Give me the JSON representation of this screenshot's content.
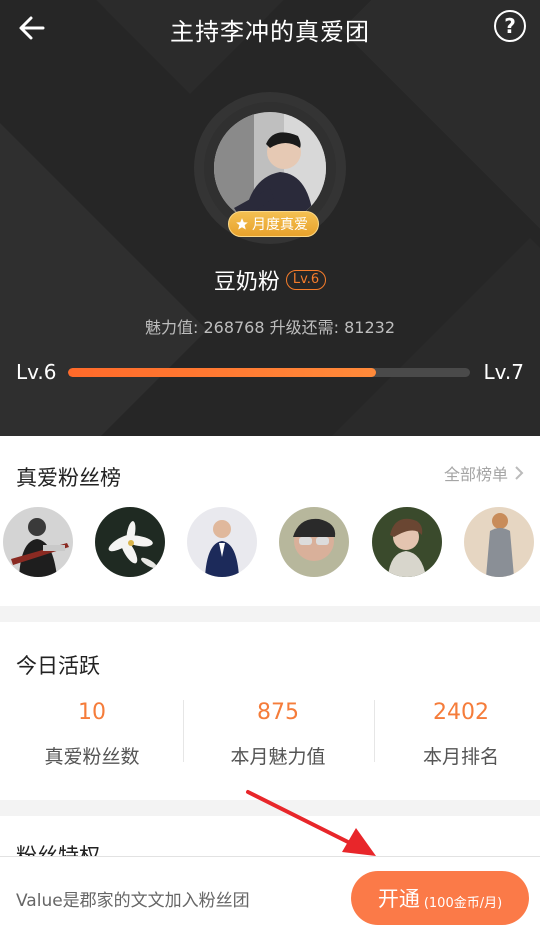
{
  "header": {
    "title": "主持李冲的真爱团",
    "back_icon": "back-arrow-icon",
    "help_icon": "question-circle-icon",
    "help_symbol": "?"
  },
  "profile": {
    "badge_label": "月度真爱",
    "badge_icon": "star-icon",
    "username": "豆奶粉",
    "level_tag": "Lv.6",
    "charm_line": "魅力值: 268768 升级还需: 81232",
    "current_level": "Lv.6",
    "next_level": "Lv.7",
    "progress_fraction": 0.766
  },
  "fans_rank": {
    "title": "真爱粉丝榜",
    "all_label": "全部榜单",
    "fan_count_shown": 6
  },
  "today_active": {
    "title": "今日活跃",
    "metrics": [
      {
        "value": "10",
        "label": "真爱粉丝数"
      },
      {
        "value": "875",
        "label": "本月魅力值"
      },
      {
        "value": "2402",
        "label": "本月排名"
      }
    ]
  },
  "privileges": {
    "title": "粉丝特权"
  },
  "bottom": {
    "join_text": "Value是郡家的文文加入粉丝团",
    "open_label": "开通",
    "price_label": "(100金币/月)"
  },
  "colors": {
    "accent": "#fb7a48",
    "metric_value": "#f57c3a",
    "hero_bg": "#262626",
    "annotation_arrow": "#e8262a"
  }
}
